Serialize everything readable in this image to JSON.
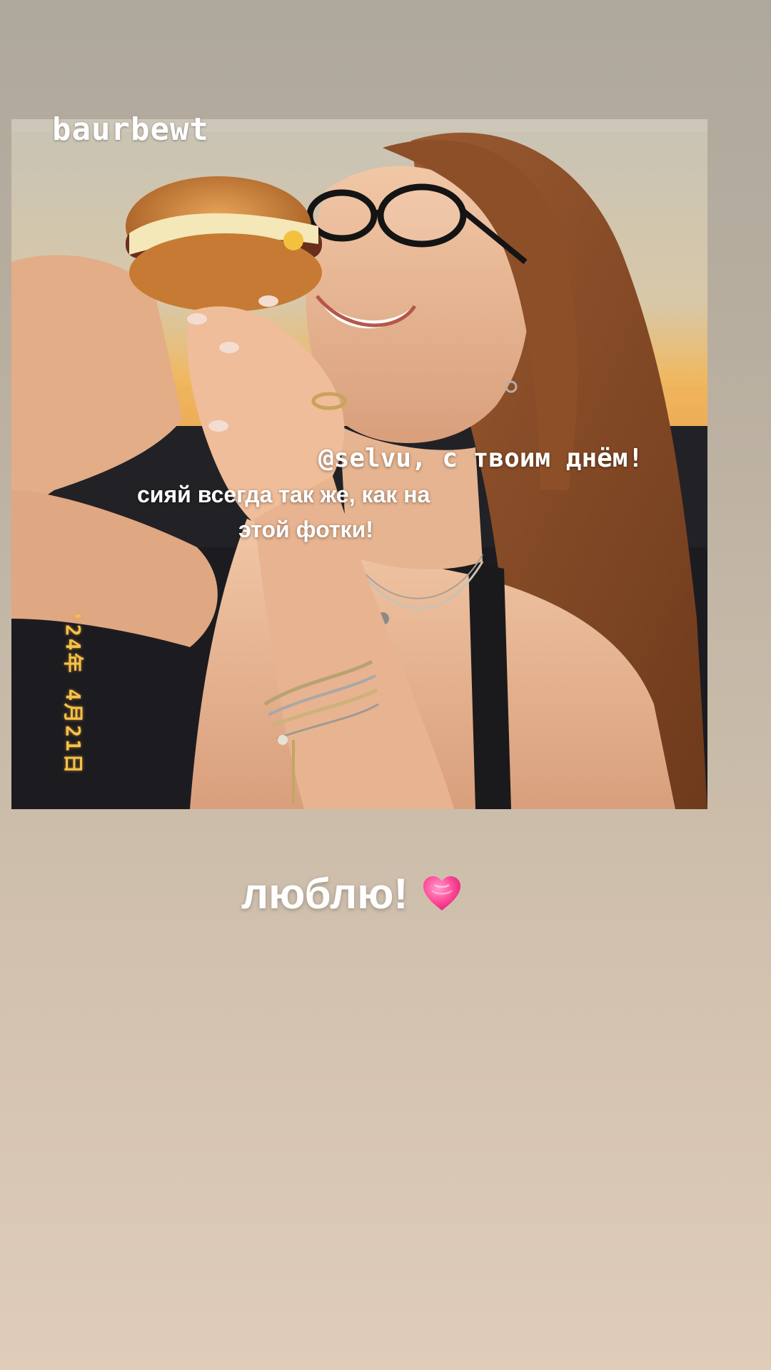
{
  "story": {
    "username": "baurbewt",
    "caption_lines": [
      "@selvu, с твоим днём!",
      "сияй всегда так же, как на",
      "этой фотки!"
    ],
    "date_stamp": "'24年 4月21日",
    "love_text": "люблю!",
    "heart_icon": "pink-heart-icon"
  },
  "colors": {
    "background_top": "#aea89c",
    "background_bottom": "#dfcdb9",
    "caption_text": "#ffffff",
    "date_stamp": "#f5c24a",
    "heart": "#ff4f9a"
  }
}
